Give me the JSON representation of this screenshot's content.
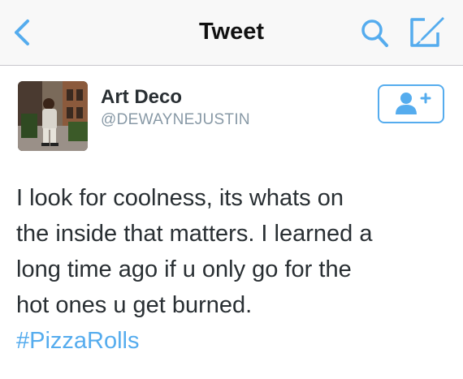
{
  "navbar": {
    "title": "Tweet",
    "back_icon": "chevron-left-icon",
    "search_icon": "search-icon",
    "compose_icon": "compose-icon"
  },
  "author": {
    "name": "Art Deco",
    "handle": "@DEWAYNEJUSTIN",
    "avatar_icon": "avatar-photo",
    "follow_icon": "add-user-icon"
  },
  "tweet": {
    "lines": [
      "I look for coolness, its whats on",
      "the inside that matters. I learned a",
      "long time ago if u only go for the",
      "hot ones u get burned."
    ],
    "hashtag": "#PizzaRolls"
  },
  "colors": {
    "accent": "#55acee",
    "text": "#292f33",
    "muted": "#8899a6",
    "navbar_bg": "#f8f8f8"
  }
}
